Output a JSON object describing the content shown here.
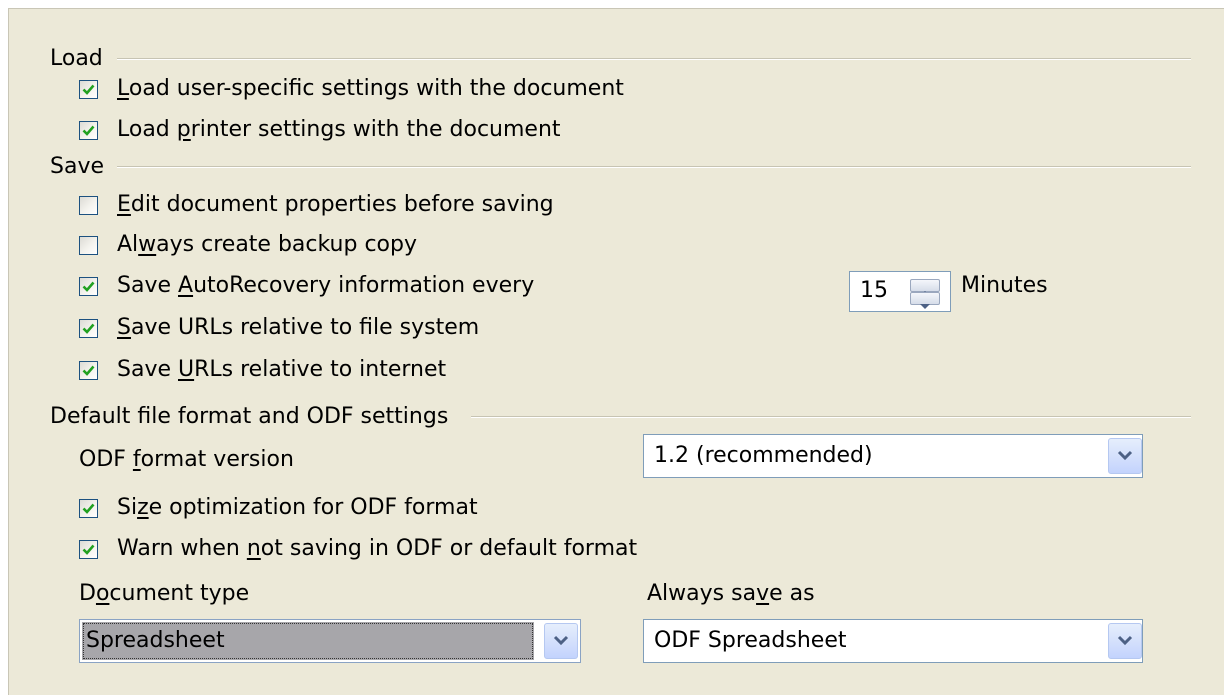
{
  "load": {
    "title": "Load",
    "user_settings": {
      "pre": "",
      "key": "L",
      "post": "oad user-specific settings with the document",
      "checked": true
    },
    "printer_settings": {
      "pre": "Load ",
      "key": "p",
      "post": "rinter settings with the document",
      "checked": true
    }
  },
  "save": {
    "title": "Save",
    "edit_properties": {
      "pre": "",
      "key": "E",
      "post": "dit document properties before saving",
      "checked": false
    },
    "backup_copy": {
      "pre": "Al",
      "key": "w",
      "post": "ays create backup copy",
      "checked": false
    },
    "autorecovery": {
      "pre": "Save ",
      "key": "A",
      "post": "utoRecovery information every",
      "checked": true
    },
    "autorecovery_minutes": "15",
    "minutes_label": "Minutes",
    "urls_filesystem": {
      "pre": "",
      "key": "S",
      "post": "ave URLs relative to file system",
      "checked": true
    },
    "urls_internet": {
      "pre": "Save ",
      "key": "U",
      "post": "RLs relative to internet",
      "checked": true
    }
  },
  "odf": {
    "title": "Default file format and ODF settings",
    "version_label": {
      "pre": "ODF ",
      "key": "f",
      "post": "ormat version"
    },
    "version_value": "1.2 (recommended)",
    "size_optimization": {
      "pre": "Si",
      "key": "z",
      "post": "e optimization for ODF format",
      "checked": true
    },
    "warn_not_odf": {
      "pre": "Warn when ",
      "key": "n",
      "post": "ot saving in ODF or default format",
      "checked": true
    },
    "doc_type_label": {
      "pre": "D",
      "key": "o",
      "post": "cument type"
    },
    "doc_type_value": "Spreadsheet",
    "always_save_label": {
      "pre": "Always sa",
      "key": "v",
      "post": "e as"
    },
    "always_save_value": "ODF Spreadsheet"
  },
  "colors": {
    "check": "#21a121",
    "panel": "#ece9d8",
    "border": "#1c5180"
  }
}
